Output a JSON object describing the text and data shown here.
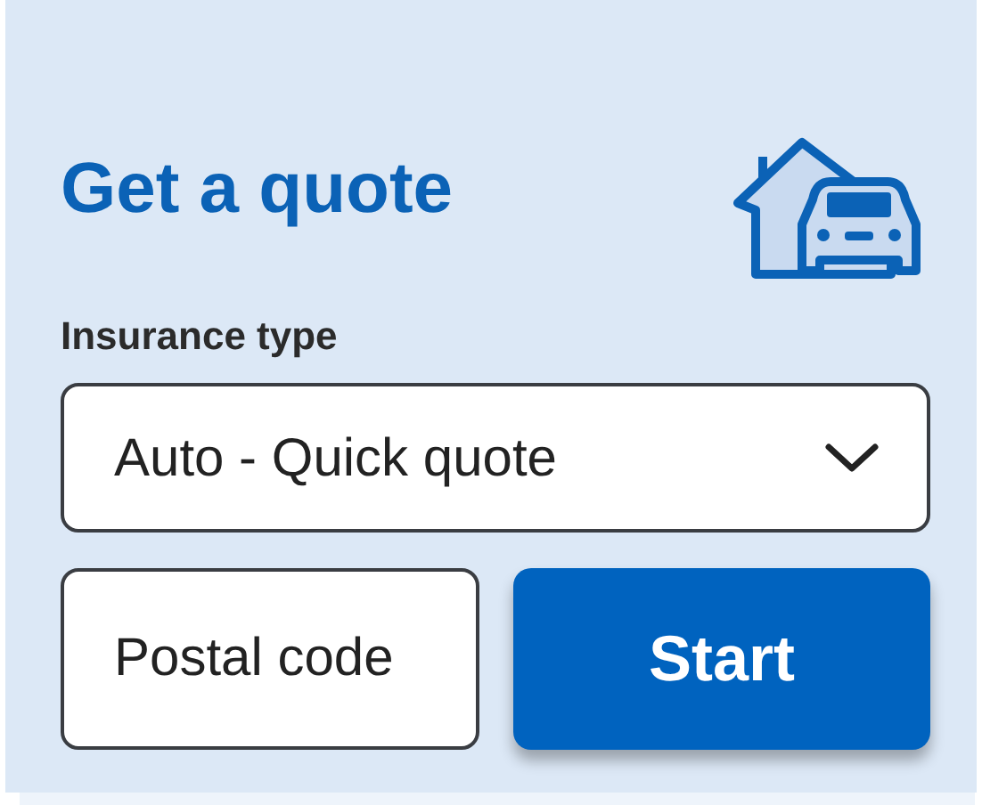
{
  "title": "Get a quote",
  "insurance_type": {
    "label": "Insurance type",
    "value": "Auto - Quick quote"
  },
  "postal_code": {
    "placeholder": "Postal code"
  },
  "start_button": "Start"
}
